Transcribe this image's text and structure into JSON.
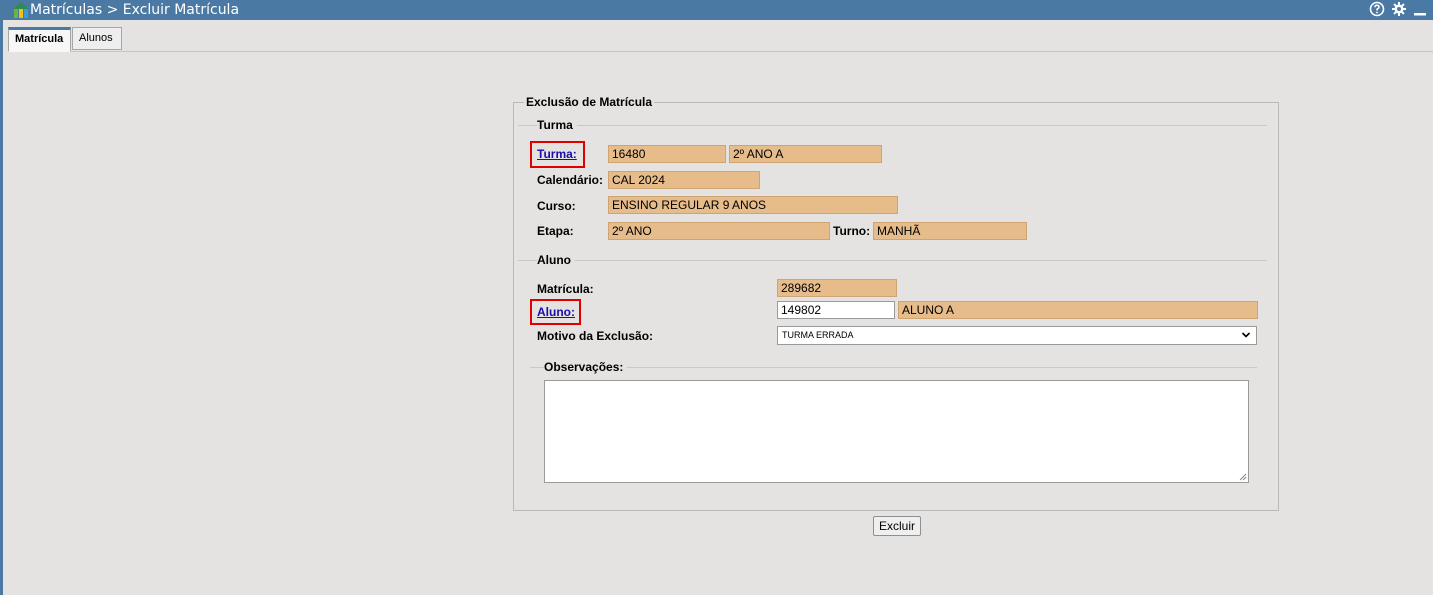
{
  "window": {
    "title": "Matrículas > Excluir Matrícula",
    "icons": [
      "help-icon",
      "gear-icon",
      "minimize-icon"
    ]
  },
  "tabs": [
    {
      "label": "Matrícula",
      "active": true
    },
    {
      "label": "Alunos",
      "active": false
    }
  ],
  "form": {
    "legend": "Exclusão de Matrícula",
    "turma_section": {
      "legend": "Turma",
      "turma_link": "Turma:",
      "turma_codigo": "16480",
      "turma_nome": "2º ANO A",
      "calendario_label": "Calendário:",
      "calendario_value": "CAL 2024",
      "curso_label": "Curso:",
      "curso_value": "ENSINO REGULAR 9 ANOS",
      "etapa_label": "Etapa:",
      "etapa_value": "2º ANO",
      "turno_label": "Turno:",
      "turno_value": "MANHÃ"
    },
    "aluno_section": {
      "legend": "Aluno",
      "matricula_label": "Matrícula:",
      "matricula_value": "289682",
      "aluno_link": "Aluno:",
      "aluno_codigo": "149802",
      "aluno_nome": "ALUNO A",
      "motivo_label": "Motivo da Exclusão:",
      "motivo_selected": "TURMA ERRADA",
      "observacoes_label": "Observações:",
      "observacoes_value": ""
    }
  },
  "actions": {
    "excluir_label": "Excluir"
  },
  "colors": {
    "titlebar": "#4a7aa3",
    "readonly_field": "#e6bc8b",
    "highlight_box": "#e00000",
    "link": "#1a0dab"
  }
}
